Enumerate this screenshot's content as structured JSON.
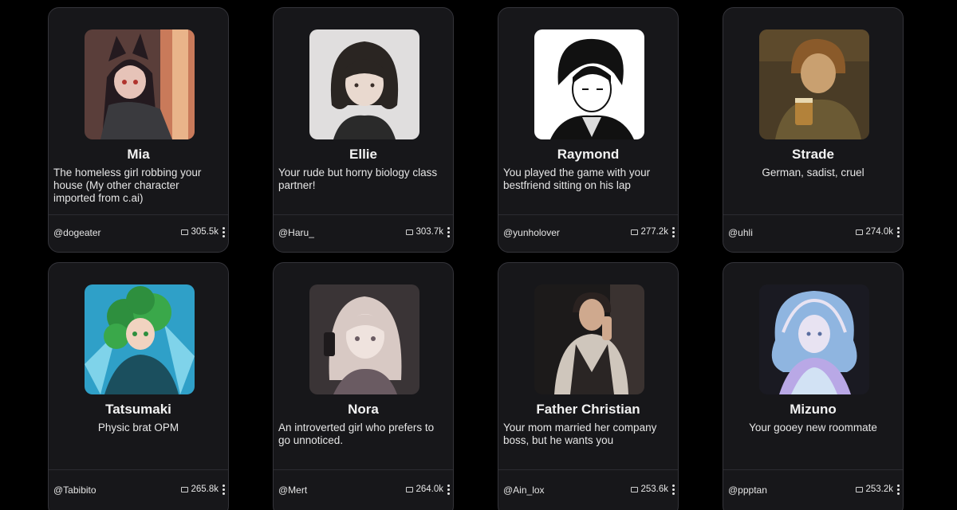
{
  "cards": [
    {
      "name": "Mia",
      "description": "The homeless girl robbing your house (My other character imported from c.ai)",
      "author": "@dogeater",
      "chats": "305.5k",
      "avatar_icon": "anime-girl-wolf-ears-avatar",
      "avatar_colors": [
        "#c97a5a",
        "#241a1f",
        "#e6c3b8"
      ]
    },
    {
      "name": "Ellie",
      "description": "Your rude but horny biology class partner!",
      "author": "@Haru_",
      "chats": "303.7k",
      "avatar_icon": "bob-haircut-girl-avatar",
      "avatar_colors": [
        "#e0dede",
        "#2a2522",
        "#e9d9cf"
      ]
    },
    {
      "name": "Raymond",
      "description": "You played the game with your bestfriend sitting on his lap",
      "author": "@yunholover",
      "chats": "277.2k",
      "avatar_icon": "manga-man-avatar",
      "avatar_colors": [
        "#ffffff",
        "#111111",
        "#dcdcdc"
      ]
    },
    {
      "name": "Strade",
      "description": "German, sadist, cruel",
      "author": "@uhli",
      "chats": "274.0k",
      "avatar_icon": "man-with-beer-avatar",
      "avatar_colors": [
        "#4a3c26",
        "#6b5a34",
        "#c0893c"
      ]
    },
    {
      "name": "Tatsumaki",
      "description": "Physic brat OPM",
      "author": "@Tabibito",
      "chats": "265.8k",
      "avatar_icon": "green-hair-girl-avatar",
      "avatar_colors": [
        "#2fa0c8",
        "#2e8f3e",
        "#1b4f5e"
      ]
    },
    {
      "name": "Nora",
      "description": "An introverted girl who prefers to go unnoticed.",
      "author": "@Mert",
      "chats": "264.0k",
      "avatar_icon": "phone-girl-avatar",
      "avatar_colors": [
        "#3a3436",
        "#d8c9c4",
        "#6a5b62"
      ]
    },
    {
      "name": "Father Christian",
      "description": "Your mom married her company boss, but he wants you",
      "author": "@Ain_lox",
      "chats": "253.6k",
      "avatar_icon": "man-in-vest-avatar",
      "avatar_colors": [
        "#1c1a1a",
        "#3a3230",
        "#cfc6bc"
      ]
    },
    {
      "name": "Mizuno",
      "description": "Your gooey new roommate",
      "author": "@ppptan",
      "chats": "253.2k",
      "avatar_icon": "crystal-slime-girl-avatar",
      "avatar_colors": [
        "#1a1a22",
        "#8fb5e0",
        "#e8e3f2"
      ]
    }
  ]
}
